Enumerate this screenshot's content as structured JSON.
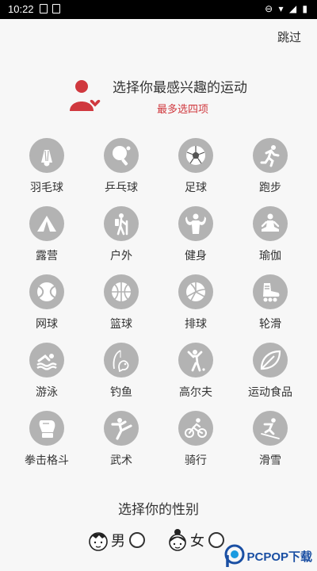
{
  "status_bar": {
    "time": "10:22"
  },
  "header": {
    "skip_label": "跳过"
  },
  "prompt": {
    "title": "选择你最感兴趣的运动",
    "subtitle": "最多选四项"
  },
  "sports": [
    {
      "label": "羽毛球",
      "icon": "badminton-icon"
    },
    {
      "label": "乒乓球",
      "icon": "table-tennis-icon"
    },
    {
      "label": "足球",
      "icon": "soccer-icon"
    },
    {
      "label": "跑步",
      "icon": "running-icon"
    },
    {
      "label": "露营",
      "icon": "tent-icon"
    },
    {
      "label": "户外",
      "icon": "hiking-icon"
    },
    {
      "label": "健身",
      "icon": "bodybuilding-icon"
    },
    {
      "label": "瑜伽",
      "icon": "yoga-icon"
    },
    {
      "label": "网球",
      "icon": "tennis-ball-icon"
    },
    {
      "label": "篮球",
      "icon": "basketball-icon"
    },
    {
      "label": "排球",
      "icon": "volleyball-icon"
    },
    {
      "label": "轮滑",
      "icon": "roller-skate-icon"
    },
    {
      "label": "游泳",
      "icon": "swimming-icon"
    },
    {
      "label": "钓鱼",
      "icon": "fishing-icon"
    },
    {
      "label": "高尔夫",
      "icon": "golf-icon"
    },
    {
      "label": "运动食品",
      "icon": "leaf-icon"
    },
    {
      "label": "拳击格斗",
      "icon": "boxing-glove-icon"
    },
    {
      "label": "武术",
      "icon": "martial-arts-icon"
    },
    {
      "label": "骑行",
      "icon": "cycling-icon"
    },
    {
      "label": "滑雪",
      "icon": "skiing-icon"
    }
  ],
  "gender": {
    "title": "选择你的性别",
    "options": [
      {
        "label": "男",
        "icon": "boy-face-icon"
      },
      {
        "label": "女",
        "icon": "girl-face-icon"
      }
    ]
  },
  "watermark": {
    "text": "PCPOP下载"
  },
  "colors": {
    "accent": "#d0383e",
    "icon_bg": "#b3b3b3"
  }
}
